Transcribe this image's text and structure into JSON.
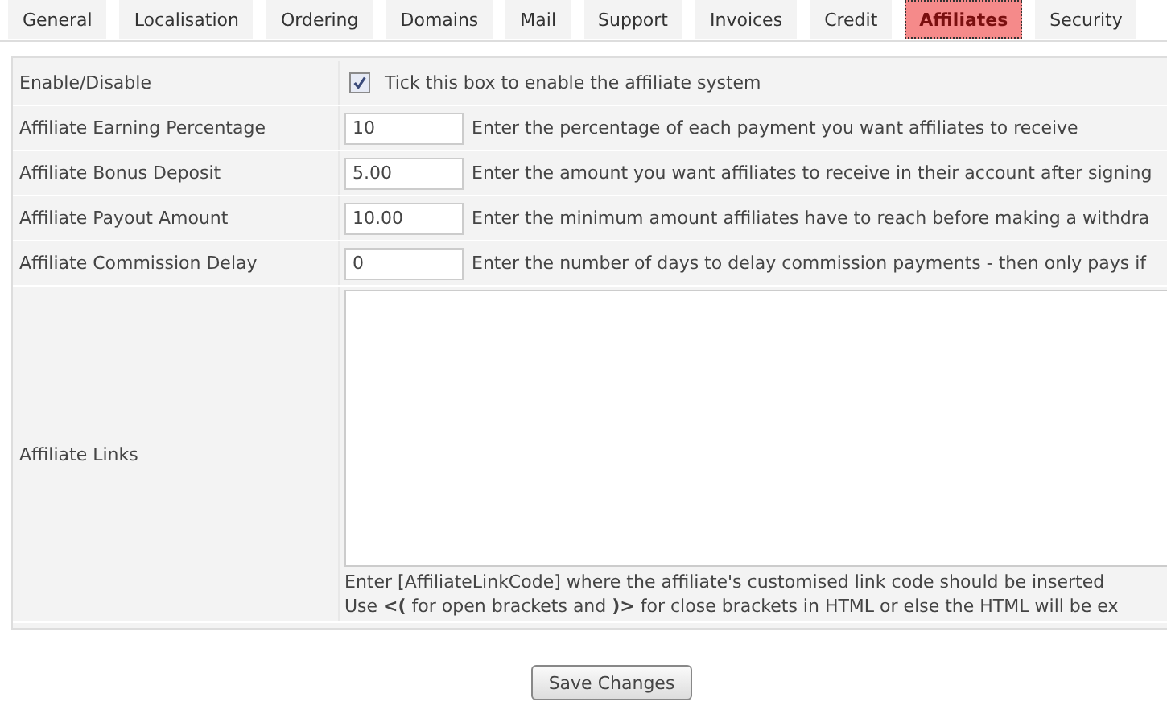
{
  "tabs": [
    {
      "label": "General",
      "selected": false
    },
    {
      "label": "Localisation",
      "selected": false
    },
    {
      "label": "Ordering",
      "selected": false
    },
    {
      "label": "Domains",
      "selected": false
    },
    {
      "label": "Mail",
      "selected": false
    },
    {
      "label": "Support",
      "selected": false
    },
    {
      "label": "Invoices",
      "selected": false
    },
    {
      "label": "Credit",
      "selected": false
    },
    {
      "label": "Affiliates",
      "selected": true
    },
    {
      "label": "Security",
      "selected": false
    }
  ],
  "settings": [
    {
      "kind": "checkbox",
      "label": "Enable/Disable",
      "checked": true,
      "description": "Tick this box to enable the affiliate system"
    },
    {
      "kind": "text",
      "label": "Affiliate Earning Percentage",
      "value": "10",
      "description": "Enter the percentage of each payment you want affiliates to receive"
    },
    {
      "kind": "text",
      "label": "Affiliate Bonus Deposit",
      "value": "5.00",
      "description": "Enter the amount you want affiliates to receive in their account after signing"
    },
    {
      "kind": "text",
      "label": "Affiliate Payout Amount",
      "value": "10.00",
      "description": "Enter the minimum amount affiliates have to reach before making a withdra"
    },
    {
      "kind": "text",
      "label": "Affiliate Commission Delay",
      "value": "0",
      "description": "Enter the number of days to delay commission payments - then only pays if"
    },
    {
      "kind": "textarea",
      "label": "Affiliate Links",
      "notes": [
        "Enter [AffiliateLinkCode] where the affiliate's customised link code should be inserted",
        "Use **<(** for open brackets and **)>** for close brackets in HTML or else the HTML will be ex"
      ]
    }
  ],
  "save_button": "Save Changes"
}
